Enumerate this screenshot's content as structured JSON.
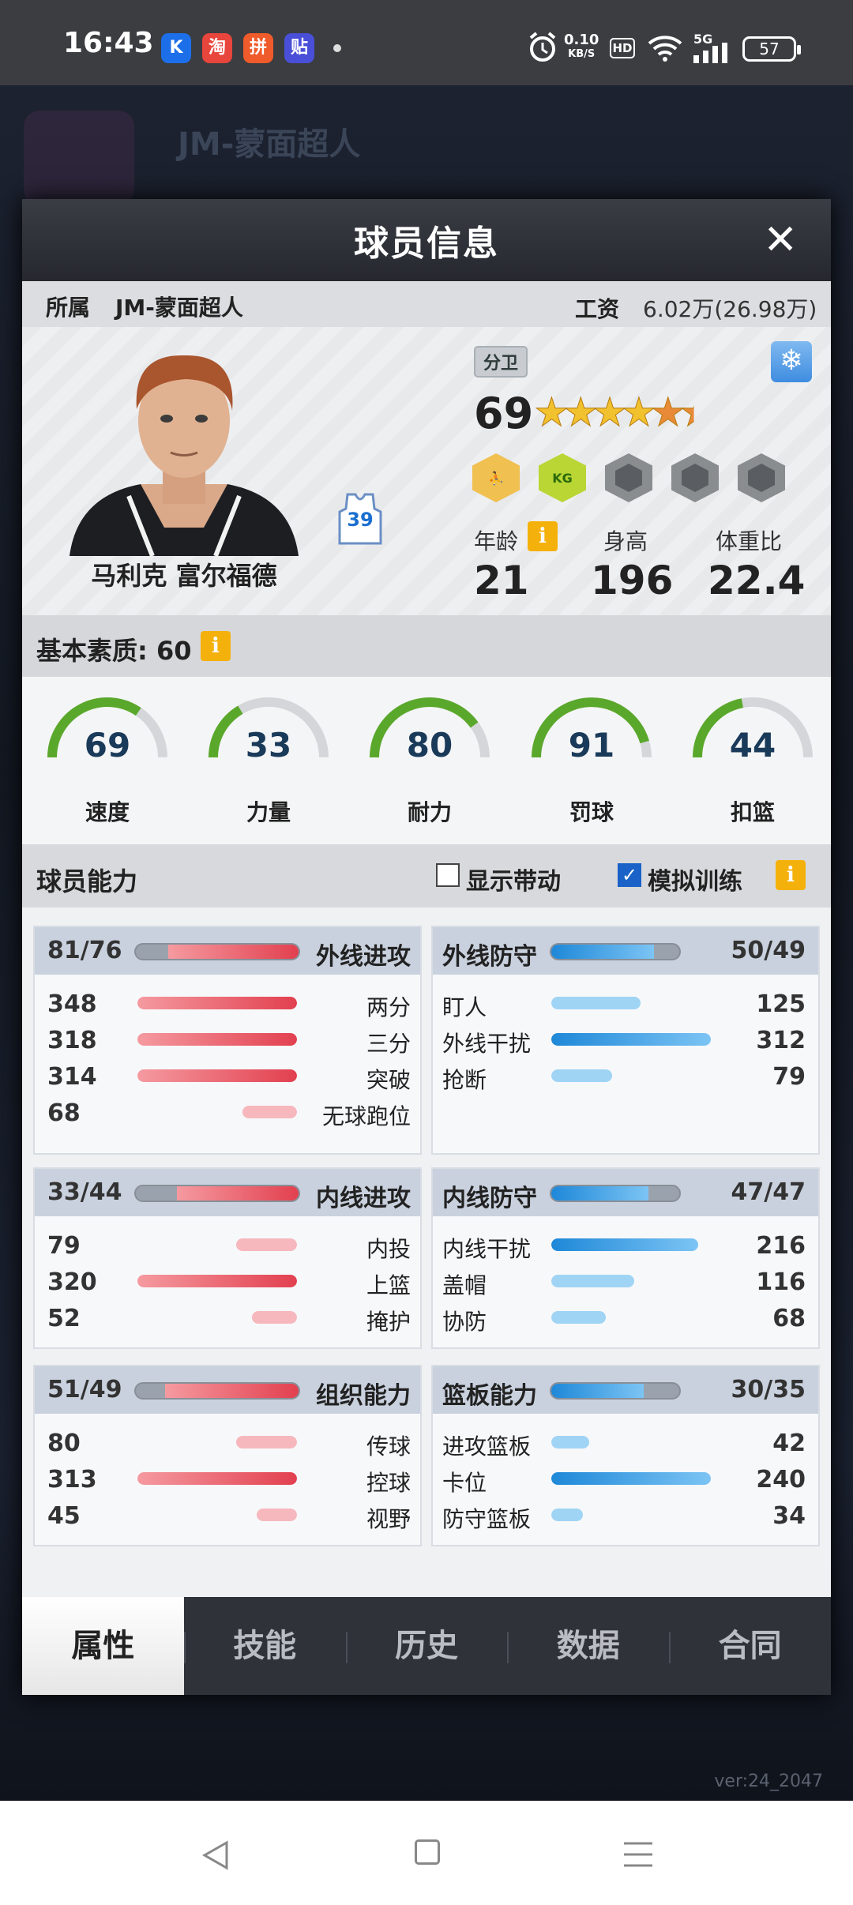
{
  "status_bar": {
    "time": "16:43",
    "apps": [
      "K",
      "淘",
      "拼",
      "贴"
    ],
    "net_speed_value": "0.10",
    "net_speed_unit": "KB/S",
    "hd": "HD",
    "signal": "5G",
    "battery": "57"
  },
  "background": {
    "team_name": "JM-蒙面超人",
    "version": "ver:24_2047"
  },
  "dialog": {
    "title": "球员信息",
    "close": "✕",
    "team_label": "所属",
    "team_value": "JM-蒙面超人",
    "salary_label": "工资",
    "salary_value": "6.02万(26.98万)",
    "player_name": "马利克 富尔福德",
    "jersey_number": "39",
    "position": "分卫",
    "overall": "69",
    "star_rating": 5.5,
    "badges": [
      "gold-player-badge",
      "kg-badge",
      "locked-badge",
      "locked-badge",
      "locked-badge"
    ],
    "kg_text": "KG",
    "age_label": "年龄",
    "age_value": "21",
    "height_label": "身高",
    "height_value": "196",
    "weight_ratio_label": "体重比",
    "weight_ratio_value": "22.4",
    "basic_label": "基本素质: 60",
    "info_icon": "i",
    "snowflake": "❄",
    "attributes": [
      {
        "label": "速度",
        "value": "69",
        "level": 69
      },
      {
        "label": "力量",
        "value": "33",
        "level": 33
      },
      {
        "label": "耐力",
        "value": "80",
        "level": 80
      },
      {
        "label": "罚球",
        "value": "91",
        "level": 91
      },
      {
        "label": "扣篮",
        "value": "44",
        "level": 44
      }
    ],
    "ability_label": "球员能力",
    "toggle_show_label": "显示带动",
    "toggle_sim_label": "模拟训练",
    "check_mark": "✓",
    "groups": [
      {
        "title": "外线进攻",
        "score": "81/76",
        "side": "off",
        "fill": 0.8,
        "rows": [
          {
            "name": "两分",
            "value": "348",
            "level": 1.0
          },
          {
            "name": "三分",
            "value": "318",
            "level": 1.0
          },
          {
            "name": "突破",
            "value": "314",
            "level": 1.0
          },
          {
            "name": "无球跑位",
            "value": "68",
            "level": 0.34
          }
        ]
      },
      {
        "title": "外线防守",
        "score": "50/49",
        "side": "def",
        "fill": 0.8,
        "rows": [
          {
            "name": "盯人",
            "value": "125",
            "level": 0.56
          },
          {
            "name": "外线干扰",
            "value": "312",
            "level": 1.0
          },
          {
            "name": "抢断",
            "value": "79",
            "level": 0.38
          }
        ]
      },
      {
        "title": "内线进攻",
        "score": "33/44",
        "side": "off",
        "fill": 0.75,
        "rows": [
          {
            "name": "内投",
            "value": "79",
            "level": 0.38
          },
          {
            "name": "上篮",
            "value": "320",
            "level": 1.0
          },
          {
            "name": "掩护",
            "value": "52",
            "level": 0.28
          }
        ]
      },
      {
        "title": "内线防守",
        "score": "47/47",
        "side": "def",
        "fill": 0.76,
        "rows": [
          {
            "name": "内线干扰",
            "value": "216",
            "level": 0.92
          },
          {
            "name": "盖帽",
            "value": "116",
            "level": 0.52
          },
          {
            "name": "协防",
            "value": "68",
            "level": 0.34
          }
        ]
      },
      {
        "title": "组织能力",
        "score": "51/49",
        "side": "off",
        "fill": 0.82,
        "rows": [
          {
            "name": "传球",
            "value": "80",
            "level": 0.38
          },
          {
            "name": "控球",
            "value": "313",
            "level": 1.0
          },
          {
            "name": "视野",
            "value": "45",
            "level": 0.25
          }
        ]
      },
      {
        "title": "篮板能力",
        "score": "30/35",
        "side": "def",
        "fill": 0.72,
        "rows": [
          {
            "name": "进攻篮板",
            "value": "42",
            "level": 0.24
          },
          {
            "name": "卡位",
            "value": "240",
            "level": 1.0
          },
          {
            "name": "防守篮板",
            "value": "34",
            "level": 0.2
          }
        ]
      }
    ],
    "tabs": [
      "属性",
      "技能",
      "历史",
      "数据",
      "合同"
    ]
  },
  "colors": {
    "offense_red": "#e2404f",
    "defense_blue": "#1e88d8",
    "gauge_green": "#5aa82b",
    "accent_yellow": "#f5b10b"
  }
}
